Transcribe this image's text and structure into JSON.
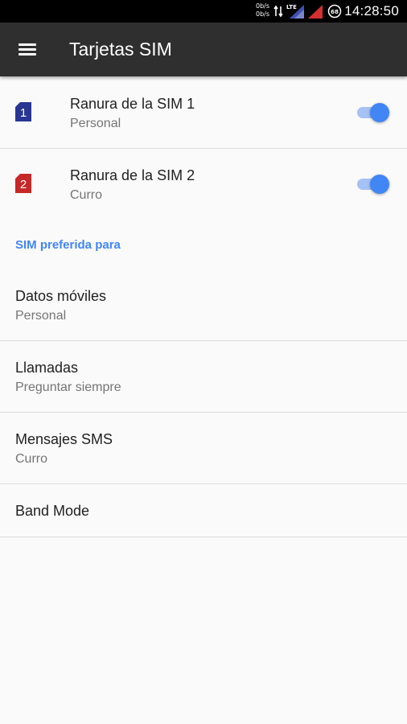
{
  "status_bar": {
    "net_up": "0b/s",
    "net_down": "0b/s",
    "network_type": "LTE",
    "battery": "68",
    "time": "14:28:50",
    "icons": [
      "data-activity-icon",
      "signal-sim1-icon",
      "signal-sim2-icon",
      "battery-icon"
    ]
  },
  "app_bar": {
    "title": "Tarjetas SIM",
    "menu_icon": "hamburger-menu-icon"
  },
  "sim_slots": [
    {
      "badge": "1",
      "title": "Ranura de la SIM 1",
      "subtitle": "Personal",
      "enabled": true,
      "color": "#283593"
    },
    {
      "badge": "2",
      "title": "Ranura de la SIM 2",
      "subtitle": "Curro",
      "enabled": true,
      "color": "#c62828"
    }
  ],
  "preferred_section": {
    "header": "SIM preferida para",
    "items": [
      {
        "title": "Datos móviles",
        "subtitle": "Personal"
      },
      {
        "title": "Llamadas",
        "subtitle": "Preguntar siempre"
      },
      {
        "title": "Mensajes SMS",
        "subtitle": "Curro"
      },
      {
        "title": "Band Mode",
        "subtitle": ""
      }
    ]
  },
  "colors": {
    "accent": "#4285f4",
    "app_bar": "#2f2f2f",
    "status_bar": "#000000",
    "background": "#fafafa"
  }
}
